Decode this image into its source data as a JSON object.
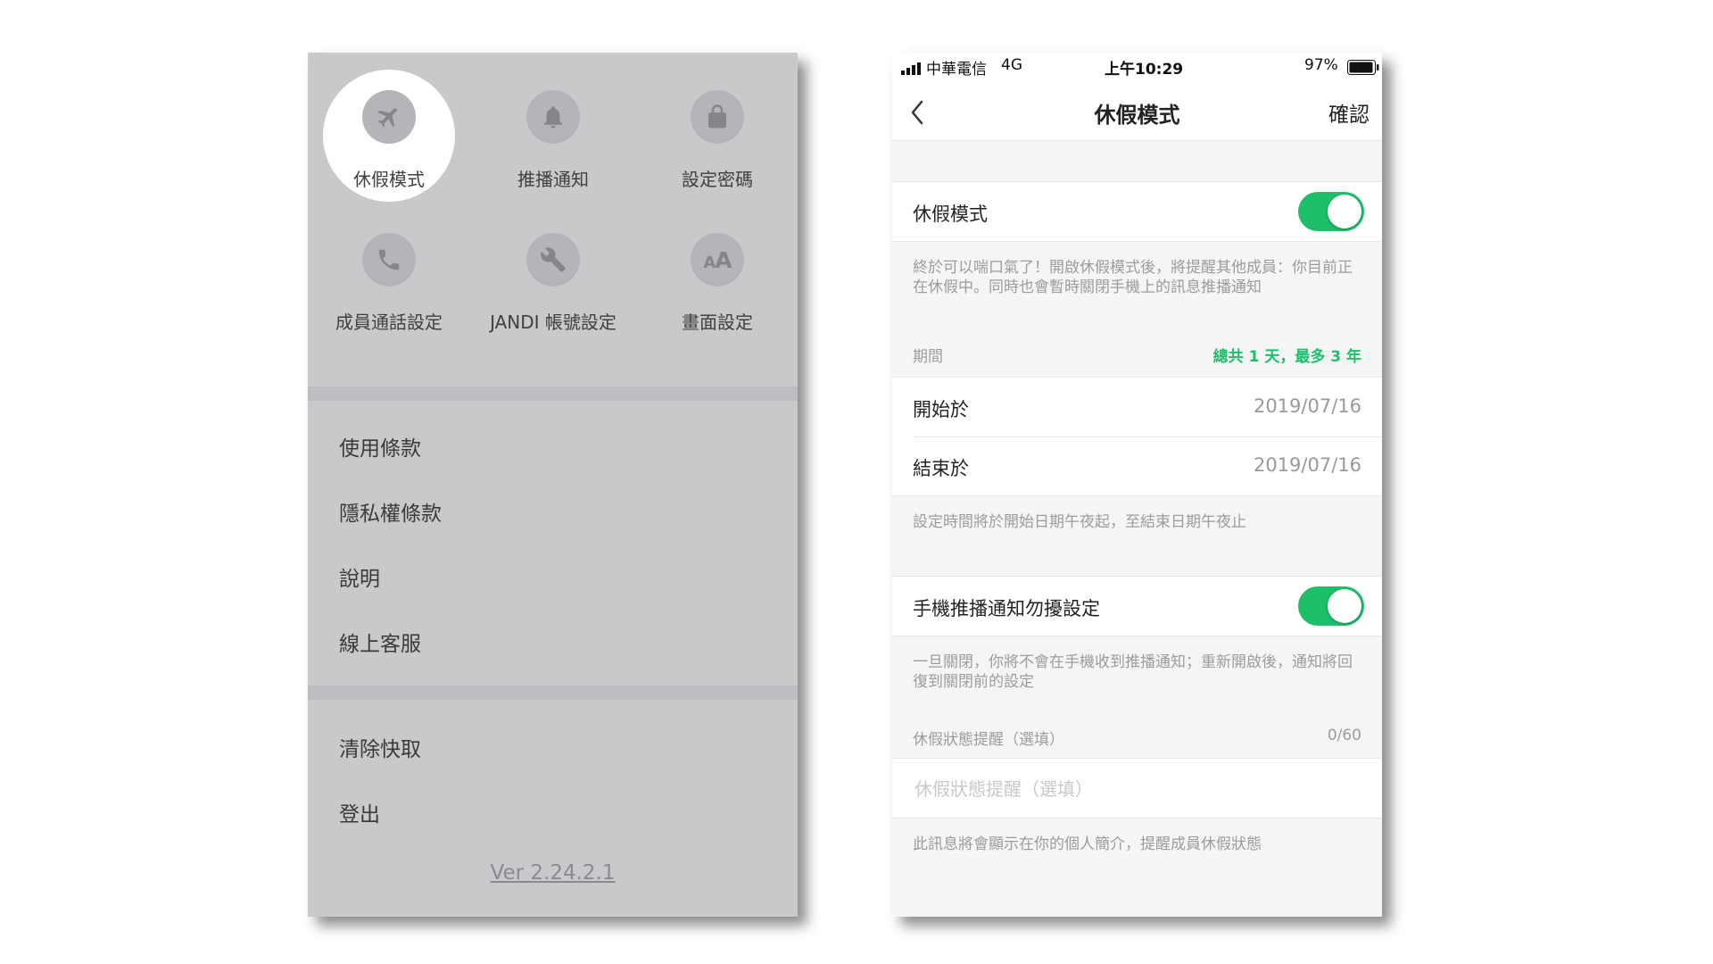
{
  "left": {
    "grid": [
      {
        "label": "休假模式",
        "icon": "airplane-icon"
      },
      {
        "label": "推播通知",
        "icon": "bell-icon"
      },
      {
        "label": "設定密碼",
        "icon": "lock-icon"
      },
      {
        "label": "成員通話設定",
        "icon": "phone-icon"
      },
      {
        "label": "JANDI 帳號設定",
        "icon": "wrench-icon"
      },
      {
        "label": "畫面設定",
        "icon": "font-size-icon",
        "glyph_small": "A",
        "glyph_big": "A"
      }
    ],
    "menu": [
      "使用條款",
      "隱私權條款",
      "說明",
      "線上客服"
    ],
    "menu2": [
      "清除快取",
      "登出"
    ],
    "version": "Ver 2.24.2.1"
  },
  "right": {
    "status": {
      "carrier": "中華電信",
      "network": "4G",
      "time": "上午10:29",
      "battery": "97%"
    },
    "nav": {
      "title": "休假模式",
      "confirm": "確認"
    },
    "vacation": {
      "label": "休假模式",
      "on": true,
      "desc": "終於可以喘口氣了！開啟休假模式後，將提醒其他成員：你目前正在休假中。同時也會暫時關閉手機上的訊息推播通知"
    },
    "period": {
      "label": "期間",
      "summary": "總共 1 天，最多 3 年",
      "start_label": "開始於",
      "start_value": "2019/07/16",
      "end_label": "結束於",
      "end_value": "2019/07/16",
      "desc": "設定時間將於開始日期午夜起，至結束日期午夜止"
    },
    "dnd": {
      "label": "手機推播通知勿擾設定",
      "on": true,
      "desc": "一旦關閉，你將不會在手機收到推播通知；重新開啟後，通知將回復到關閉前的設定"
    },
    "reminder": {
      "label": "休假狀態提醒（選填）",
      "count": "0/60",
      "placeholder": "休假狀態提醒（選填）",
      "desc": "此訊息將會顯示在你的個人簡介，提醒成員休假狀態"
    }
  },
  "colors": {
    "accent_green": "#1dbf6b",
    "panel_gray": "#c8c9cb"
  }
}
